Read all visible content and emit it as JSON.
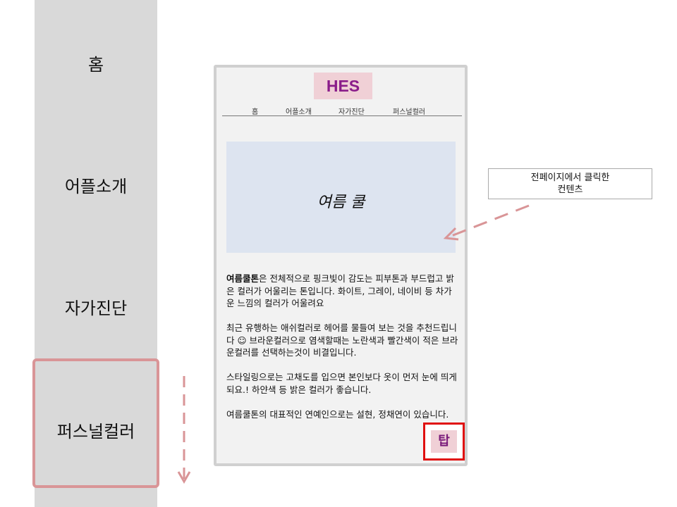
{
  "sidebar": {
    "items": [
      {
        "label": "홈"
      },
      {
        "label": "어플소개"
      },
      {
        "label": "자가진단"
      },
      {
        "label": "퍼스널컬러"
      }
    ]
  },
  "phone": {
    "logo": "HES",
    "nav": [
      "홈",
      "어플소개",
      "자가진단",
      "퍼스널컬러"
    ],
    "hero_title": "여름 쿨",
    "content": {
      "p1_bold": "여름쿨톤",
      "p1_rest": "은  전체적으로 핑크빛이 감도는 피부톤과 부드럽고 밝은 컬러가 어울리는 톤입니다. 화이트, 그레이, 네이비 등 차가운 느낌의 컬러가 어울려요",
      "p2": "최근 유행하는 애쉬컬러로 헤어를 물들여 보는 것을 추천드립니다 ☺ 브라운컬러으로 염색할때는 노란색과 빨간색이 적은 브라운컬러를 선택하는것이 비결입니다.",
      "p3": "스타일링으로는 고채도를 입으면 본인보다 옷이 먼저 눈에 띄게 되요.! 하얀색 등 밝은 컬러가 좋습니다.",
      "p4": "여름쿨톤의 대표적인 연예인으로는 설현,  정채연이 있습니다."
    },
    "top_button": "탑"
  },
  "callout": {
    "line1": "전페이지에서 클릭한",
    "line2": "컨텐츠"
  },
  "colors": {
    "sidebar_bg": "#d9d9d9",
    "highlight": "#d99597",
    "logo_bg": "#f0d0d6",
    "logo_text": "#8a1d8a",
    "hero_bg": "#dde4f0",
    "top_border": "#e01010"
  }
}
